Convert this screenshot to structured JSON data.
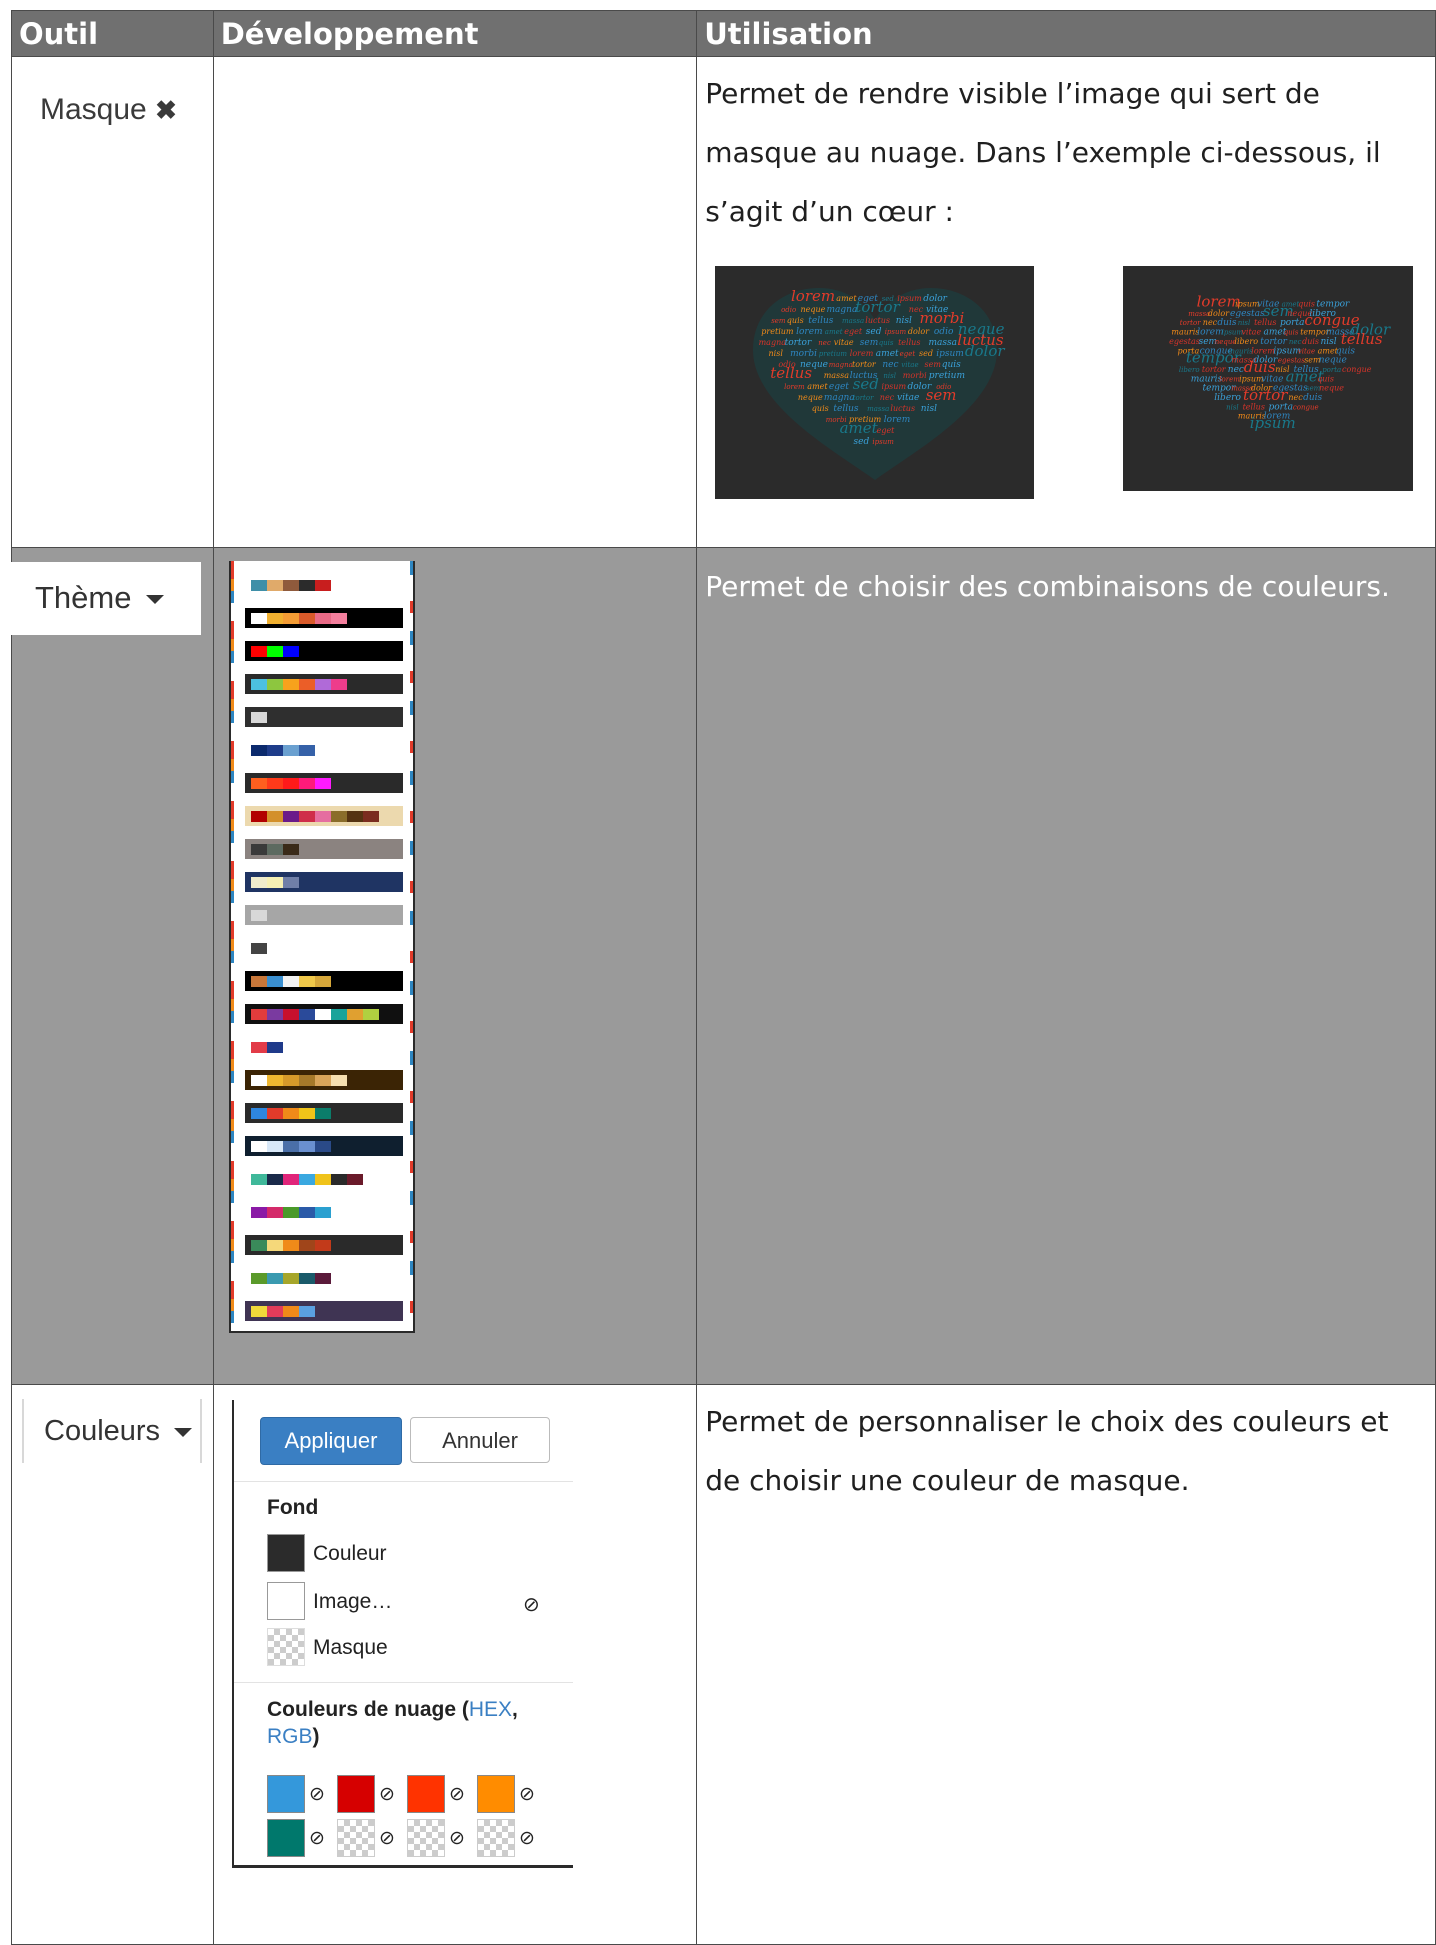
{
  "table": {
    "headers": {
      "outil": "Outil",
      "developpement": "Développement",
      "utilisation": "Utilisation"
    }
  },
  "rows": {
    "masque": {
      "tool_label": "Masque",
      "tool_icon": "close-icon",
      "usage": "Permet de rendre visible l’image qui sert de masque au nuage. Dans l’exemple ci-dessous, il s’agit d’un cœur :"
    },
    "theme": {
      "tool_label": "Thème",
      "usage": "Permet de choisir des combinaisons de couleurs.",
      "palettes": [
        {
          "bg": "#ffffff",
          "colors": [
            "#3f8fa8",
            "#e0aa6a",
            "#8f5a3c",
            "#2b2b2b",
            "#c81e1e"
          ]
        },
        {
          "bg": "#000000",
          "colors": [
            "#ffffff",
            "#f0b030",
            "#f39c35",
            "#d85a2a",
            "#e86a86",
            "#f37f9d"
          ]
        },
        {
          "bg": "#000000",
          "colors": [
            "#ff0000",
            "#00ff00",
            "#0000ff"
          ]
        },
        {
          "bg": "#2a2a2a",
          "colors": [
            "#4cc0e0",
            "#8dc63f",
            "#f7a21c",
            "#eb5e28",
            "#b06ad8",
            "#ee3c8b"
          ]
        },
        {
          "bg": "#2f2f2f",
          "colors": [
            "#d8d8d8"
          ]
        },
        {
          "bg": "#ffffff",
          "colors": [
            "#0b2a6d",
            "#1e3c8a",
            "#6aa0d0",
            "#3561a8"
          ]
        },
        {
          "bg": "#2a2a2a",
          "colors": [
            "#ff5f1f",
            "#ff3a1a",
            "#ff1a1a",
            "#ff1a7a",
            "#ff1aff"
          ]
        },
        {
          "bg": "#ecd9ae",
          "colors": [
            "#b20000",
            "#d3902a",
            "#6a1a8a",
            "#cf2e4a",
            "#e56ea0",
            "#8a6d2a",
            "#553311",
            "#7b2d1f"
          ]
        },
        {
          "bg": "#8b8380",
          "colors": [
            "#3a3a3a",
            "#5d6a60",
            "#3a2a18"
          ]
        },
        {
          "bg": "#1f3463",
          "colors": [
            "#f0eccc",
            "#f6f0b4",
            "#707fa8"
          ]
        },
        {
          "bg": "#a6a6a6",
          "colors": [
            "#d8d8d8"
          ]
        },
        {
          "bg": "#ffffff",
          "colors": [
            "#444444"
          ]
        },
        {
          "bg": "#000000",
          "colors": [
            "#c8773a",
            "#3a8fd0",
            "#f2f2f2",
            "#f0c84a",
            "#d6a73a"
          ]
        },
        {
          "bg": "#101010",
          "colors": [
            "#e23c3c",
            "#7a3aa0",
            "#c8102e",
            "#2a4a9a",
            "#ffffff",
            "#1aa39a",
            "#e0a030",
            "#b0d040"
          ]
        },
        {
          "bg": "#ffffff",
          "colors": [
            "#e23b48",
            "#1f3a8a"
          ]
        },
        {
          "bg": "#3b2405",
          "colors": [
            "#ffffff",
            "#f0b830",
            "#d79a2a",
            "#a6792a",
            "#d9a55a",
            "#f6dfb0"
          ]
        },
        {
          "bg": "#2a2a2a",
          "colors": [
            "#2e86de",
            "#e23b2a",
            "#f08a19",
            "#f0c419",
            "#0b7d6a"
          ]
        },
        {
          "bg": "#0f1f2f",
          "colors": [
            "#ffffff",
            "#d8e8f8",
            "#4a6fa8",
            "#6a90d0",
            "#2a4a88"
          ]
        },
        {
          "bg": "#ffffff",
          "colors": [
            "#3fb89a",
            "#1a2a4a",
            "#e0257a",
            "#3aa8e0",
            "#f0c31a",
            "#2a2a2a",
            "#6a1a2a"
          ]
        },
        {
          "bg": "#ffffff",
          "colors": [
            "#8a1aa6",
            "#d42a6a",
            "#4a9a2a",
            "#2a5aa8",
            "#2aa0d0"
          ]
        },
        {
          "bg": "#2a2a2a",
          "colors": [
            "#3a8a5a",
            "#f5d87a",
            "#f08a19",
            "#a0451a",
            "#c23a1a"
          ]
        },
        {
          "bg": "#ffffff",
          "colors": [
            "#5a9a2a",
            "#3a9ab0",
            "#a6a62a",
            "#1a5a6a",
            "#5a1a3a"
          ]
        },
        {
          "bg": "#3f3453",
          "colors": [
            "#f0d83a",
            "#e23c5a",
            "#f08a19",
            "#5aa0e0"
          ]
        }
      ]
    },
    "couleurs": {
      "tool_label": "Couleurs",
      "usage": "Permet de personnaliser le choix des couleurs et de choisir une couleur de masque.",
      "panel": {
        "apply_label": "Appliquer",
        "cancel_label": "Annuler",
        "fond_header": "Fond",
        "fond_options": [
          {
            "label": "Couleur",
            "color": "#2b2b2b"
          },
          {
            "label": "Image…",
            "color": "#ffffff",
            "clear_icon": "⊘"
          },
          {
            "label": "Masque",
            "color": "checker"
          }
        ],
        "cloud_header": "Couleurs de nuage (",
        "cloud_link_hex": "HEX",
        "cloud_comma": ",",
        "cloud_link_rgb": "RGB",
        "cloud_close": ")",
        "clear_symbol": "⊘",
        "cloud_colors": [
          "#3498db",
          "#d60000",
          "#ff3300",
          "#ff8c00",
          "#00786c",
          "checker",
          "checker",
          "checker"
        ]
      }
    }
  },
  "heart_words_left": [
    "lorem",
    "amet",
    "eget",
    "sed",
    "ipsum",
    "dolor",
    "odio",
    "neque",
    "magna",
    "tortor",
    "nec",
    "vitae",
    "sem",
    "quis",
    "tellus",
    "massa",
    "luctus",
    "nisl",
    "morbi",
    "pretium"
  ],
  "heart_words_right": [
    "lorem",
    "ipsum",
    "vitae",
    "amet",
    "quis",
    "tempor",
    "massa",
    "dolor",
    "egestas",
    "sem",
    "neque",
    "libero",
    "tortor",
    "nec",
    "duis",
    "nisl",
    "tellus",
    "porta",
    "congue",
    "mauris"
  ]
}
